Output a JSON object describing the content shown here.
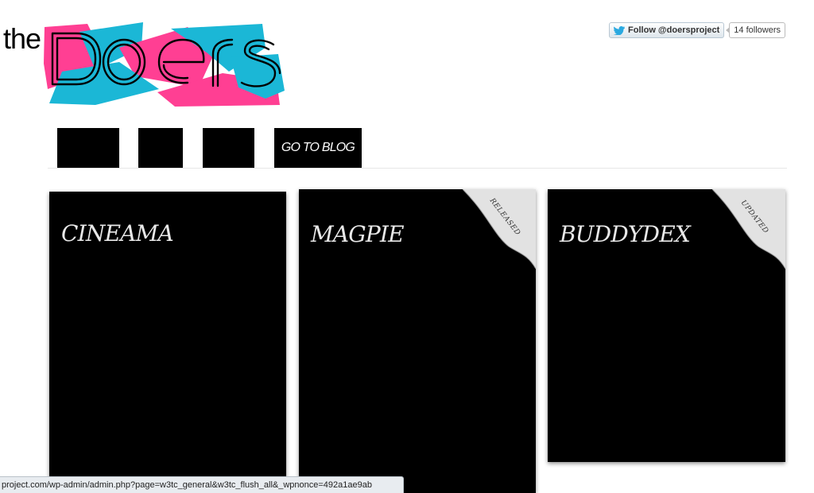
{
  "header": {
    "logo_prefix": "the",
    "logo_word": "DOERS",
    "brand_colors": {
      "pink": "#ff3f93",
      "cyan": "#1bb7d6"
    }
  },
  "twitter": {
    "follow_label": "Follow @doersproject",
    "follower_count": "14 followers",
    "icon": "twitter-bird-icon"
  },
  "nav": {
    "items": [
      {
        "label": ""
      },
      {
        "label": ""
      },
      {
        "label": ""
      },
      {
        "label": "GO TO BLOG"
      }
    ]
  },
  "projects": [
    {
      "title": "CINEAMA",
      "badge": ""
    },
    {
      "title": "MAGPIE",
      "badge": "RELEASED"
    },
    {
      "title": "BUDDYDEX",
      "badge": "UPDATED"
    }
  ],
  "status_bar": {
    "url": "project.com/wp-admin/admin.php?page=w3tc_general&w3tc_flush_all&_wpnonce=492a1ae9ab"
  }
}
